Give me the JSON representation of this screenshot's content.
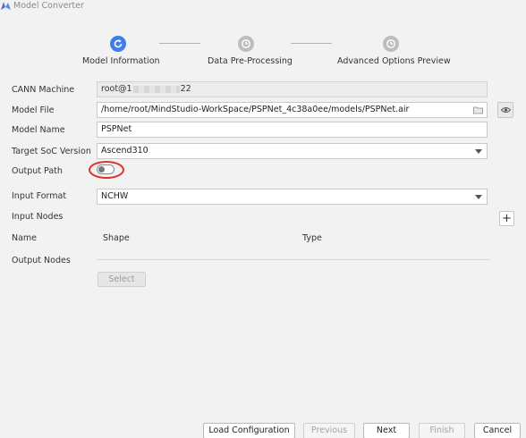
{
  "window": {
    "title": "Model Converter"
  },
  "steps": [
    {
      "label": "Model Information",
      "state": "active"
    },
    {
      "label": "Data Pre-Processing",
      "state": "pending"
    },
    {
      "label": "Advanced Options Preview",
      "state": "pending"
    }
  ],
  "form": {
    "cann_machine": {
      "label": "CANN Machine",
      "value_prefix": "root@1",
      "value_suffix": "22"
    },
    "model_file": {
      "label": "Model File",
      "value": "/home/root/MindStudio-WorkSpace/PSPNet_4c38a0ee/models/PSPNet.air",
      "icon": "folder-icon"
    },
    "model_name": {
      "label": "Model Name",
      "value": "PSPNet"
    },
    "target_soc": {
      "label": "Target SoC Version",
      "value": "Ascend310"
    },
    "output_path": {
      "label": "Output Path",
      "toggle_on": false
    },
    "input_format": {
      "label": "Input Format",
      "value": "NCHW"
    },
    "input_nodes": {
      "label": "Input Nodes",
      "columns": [
        "Name",
        "Shape",
        "Type"
      ],
      "add_symbol": "+"
    },
    "output_nodes": {
      "label": "Output Nodes",
      "select_label": "Select"
    }
  },
  "footer": {
    "load_label": "Load Configuration",
    "previous_label": "Previous",
    "next_label": "Next",
    "finish_label": "Finish",
    "cancel_label": "Cancel"
  },
  "colors": {
    "accent": "#3d7fe6",
    "annotation": "#e03131"
  }
}
